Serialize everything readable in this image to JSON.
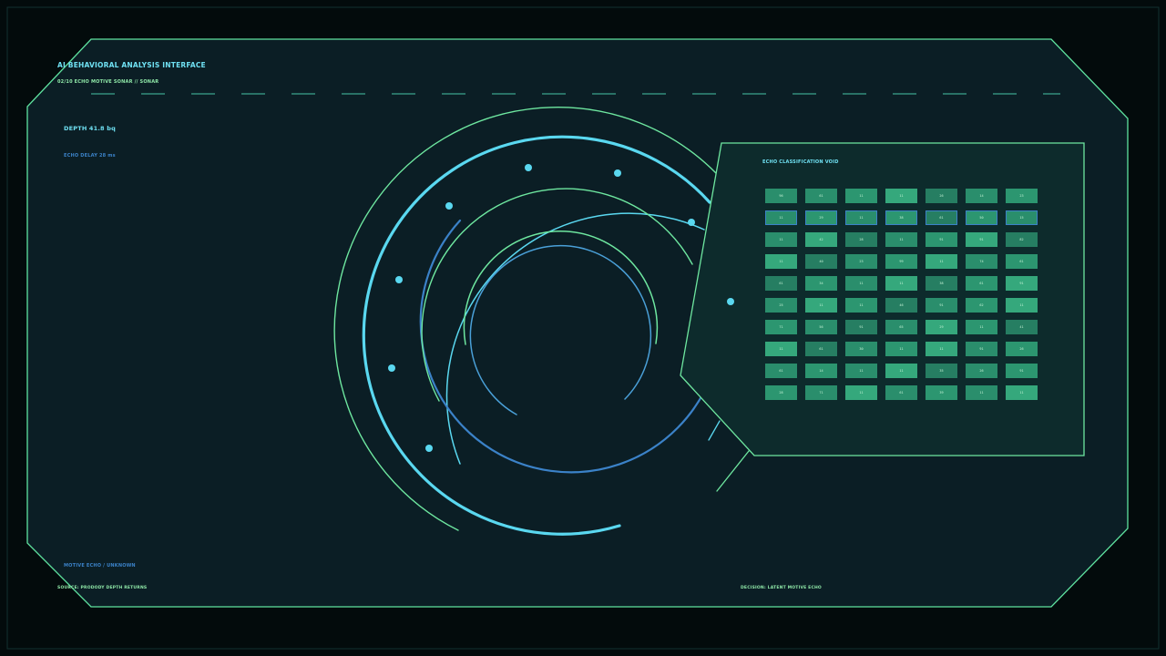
{
  "header": {
    "title": "AI BEHAVIORAL ANALYSIS INTERFACE",
    "subtitle": "02/10 ECHO MOTIVE SONAR // SONAR"
  },
  "readouts": {
    "depth": "DEPTH 41.8 bq",
    "echo_delay": "ECHO DELAY 28 ms",
    "motive": "MOTIVE ECHO / UNKNOWN"
  },
  "footer": {
    "source": "SOURCE: PRODODY DEPTH RETURNS",
    "decision": "DECISION: LATENT MOTIVE ECHO"
  },
  "panel": {
    "title": "ECHO CLASSIFICATION VOID",
    "selected_row": 1,
    "rows": [
      {
        "cells": [
          {
            "label": "96",
            "shade": "#2a8e6c"
          },
          {
            "label": "61",
            "shade": "#2a8e6c"
          },
          {
            "label": "11",
            "shade": "#2c9670"
          },
          {
            "label": "11",
            "shade": "#35a87c"
          },
          {
            "label": "26",
            "shade": "#267e62"
          },
          {
            "label": "14",
            "shade": "#2a8e6c"
          },
          {
            "label": "23",
            "shade": "#2c9670"
          }
        ]
      },
      {
        "cells": [
          {
            "label": "11",
            "shade": "#2a8e6c"
          },
          {
            "label": "29",
            "shade": "#2c9670"
          },
          {
            "label": "11",
            "shade": "#2a8e6c"
          },
          {
            "label": "38",
            "shade": "#2c9670"
          },
          {
            "label": "61",
            "shade": "#267e62"
          },
          {
            "label": "50",
            "shade": "#2c9670"
          },
          {
            "label": "15",
            "shade": "#2a8e6c"
          }
        ]
      },
      {
        "cells": [
          {
            "label": "11",
            "shade": "#2a8e6c"
          },
          {
            "label": "42",
            "shade": "#35a87c"
          },
          {
            "label": "28",
            "shade": "#267e62"
          },
          {
            "label": "11",
            "shade": "#2a8e6c"
          },
          {
            "label": "91",
            "shade": "#2c9670"
          },
          {
            "label": "91",
            "shade": "#35a87c"
          },
          {
            "label": "82",
            "shade": "#267e62"
          }
        ]
      },
      {
        "cells": [
          {
            "label": "11",
            "shade": "#35a87c"
          },
          {
            "label": "40",
            "shade": "#267e62"
          },
          {
            "label": "23",
            "shade": "#2a8e6c"
          },
          {
            "label": "99",
            "shade": "#2c9670"
          },
          {
            "label": "11",
            "shade": "#35a87c"
          },
          {
            "label": "74",
            "shade": "#2a8e6c"
          },
          {
            "label": "61",
            "shade": "#2c9670"
          }
        ]
      },
      {
        "cells": [
          {
            "label": "61",
            "shade": "#267e62"
          },
          {
            "label": "34",
            "shade": "#2c9670"
          },
          {
            "label": "11",
            "shade": "#2a8e6c"
          },
          {
            "label": "11",
            "shade": "#35a87c"
          },
          {
            "label": "38",
            "shade": "#267e62"
          },
          {
            "label": "61",
            "shade": "#2c9670"
          },
          {
            "label": "91",
            "shade": "#35a87c"
          }
        ]
      },
      {
        "cells": [
          {
            "label": "25",
            "shade": "#2a8e6c"
          },
          {
            "label": "11",
            "shade": "#35a87c"
          },
          {
            "label": "11",
            "shade": "#2c9670"
          },
          {
            "label": "46",
            "shade": "#267e62"
          },
          {
            "label": "91",
            "shade": "#2a8e6c"
          },
          {
            "label": "62",
            "shade": "#2c9670"
          },
          {
            "label": "11",
            "shade": "#35a87c"
          }
        ]
      },
      {
        "cells": [
          {
            "label": "71",
            "shade": "#2c9670"
          },
          {
            "label": "56",
            "shade": "#2a8e6c"
          },
          {
            "label": "91",
            "shade": "#267e62"
          },
          {
            "label": "65",
            "shade": "#2a8e6c"
          },
          {
            "label": "29",
            "shade": "#35a87c"
          },
          {
            "label": "11",
            "shade": "#2c9670"
          },
          {
            "label": "41",
            "shade": "#267e62"
          }
        ]
      },
      {
        "cells": [
          {
            "label": "11",
            "shade": "#35a87c"
          },
          {
            "label": "61",
            "shade": "#267e62"
          },
          {
            "label": "30",
            "shade": "#2a8e6c"
          },
          {
            "label": "11",
            "shade": "#2c9670"
          },
          {
            "label": "11",
            "shade": "#35a87c"
          },
          {
            "label": "91",
            "shade": "#2a8e6c"
          },
          {
            "label": "26",
            "shade": "#2c9670"
          }
        ]
      },
      {
        "cells": [
          {
            "label": "61",
            "shade": "#2a8e6c"
          },
          {
            "label": "14",
            "shade": "#2c9670"
          },
          {
            "label": "11",
            "shade": "#2a8e6c"
          },
          {
            "label": "11",
            "shade": "#35a87c"
          },
          {
            "label": "35",
            "shade": "#267e62"
          },
          {
            "label": "26",
            "shade": "#2a8e6c"
          },
          {
            "label": "91",
            "shade": "#2c9670"
          }
        ]
      },
      {
        "cells": [
          {
            "label": "28",
            "shade": "#2c9670"
          },
          {
            "label": "71",
            "shade": "#2a8e6c"
          },
          {
            "label": "11",
            "shade": "#35a87c"
          },
          {
            "label": "61",
            "shade": "#2a8e6c"
          },
          {
            "label": "39",
            "shade": "#2c9670"
          },
          {
            "label": "11",
            "shade": "#2a8e6c"
          },
          {
            "label": "11",
            "shade": "#35a87c"
          }
        ]
      }
    ]
  },
  "colors": {
    "background": "#030b0c",
    "frame_fill": "#0b1e25",
    "frame_stroke": "#5fe3a0",
    "cyan": "#5ad8f0",
    "blue": "#3b82c8",
    "green": "#6ee7a0",
    "panel_fill": "#0d2b2c",
    "selection": "#3b82c8"
  },
  "icons": {
    "sonar": "concentric-rings-radar",
    "blips": "cyan-dot"
  }
}
